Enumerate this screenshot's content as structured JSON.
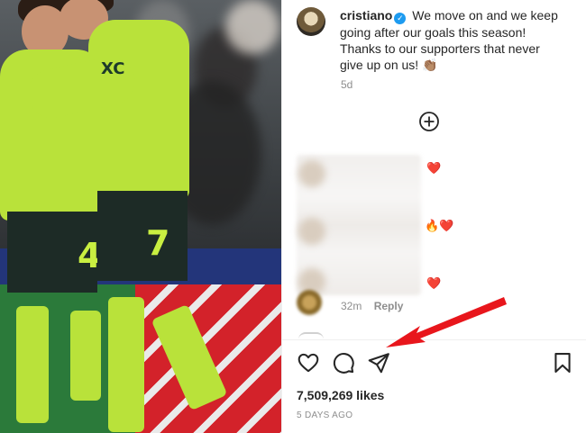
{
  "post": {
    "username": "cristiano",
    "caption_text": "We move on and we keep going after our goals this season! Thanks to our supporters that never give up on us!",
    "caption_emoji": "👏🏽",
    "caption_time": "5d",
    "likes": "7,509,269 likes",
    "date": "5 DAYS AGO"
  },
  "comments": {
    "items": [
      {
        "reaction": "❤️"
      },
      {
        "reaction": "🔥❤️"
      },
      {
        "reaction": "❤️"
      }
    ],
    "last_time": "32m",
    "reply_label": "Reply"
  },
  "photo": {
    "player_numbers": [
      "4",
      "7"
    ],
    "kit_sponsor": "XC"
  },
  "colors": {
    "accent_annotation": "#e8161c",
    "verified_blue": "#1d9bf0",
    "kit_lime": "#b9e23a"
  },
  "icons": {
    "load_more": "plus-circle-icon",
    "like": "heart-icon",
    "comment": "comment-bubble-icon",
    "share": "paper-plane-icon",
    "save": "bookmark-icon"
  }
}
